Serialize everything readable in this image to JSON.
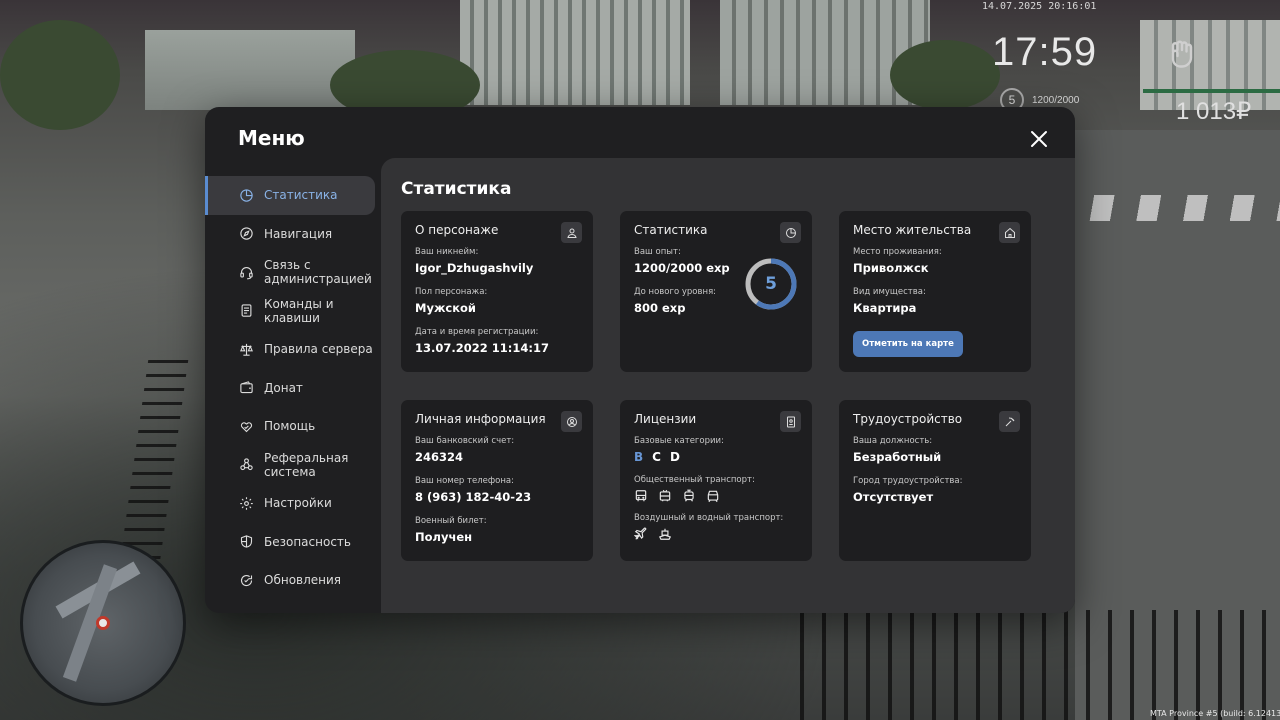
{
  "hud": {
    "datetime": "14.07.2025 20:16:01",
    "time": "17:59",
    "level": "5",
    "exp": "1200/2000",
    "money": "1 013₽",
    "build": "MTA Province #5 (build: 6.12413.9"
  },
  "menu": {
    "title": "Меню",
    "sidebar": [
      {
        "label": "Статистика",
        "icon": "pie-chart-icon",
        "active": true
      },
      {
        "label": "Навигация",
        "icon": "compass-icon"
      },
      {
        "label": "Связь с администрацией",
        "icon": "headset-icon"
      },
      {
        "label": "Команды и клавиши",
        "icon": "document-icon"
      },
      {
        "label": "Правила сервера",
        "icon": "scales-icon"
      },
      {
        "label": "Донат",
        "icon": "wallet-icon"
      },
      {
        "label": "Помощь",
        "icon": "heart-hand-icon"
      },
      {
        "label": "Реферальная система",
        "icon": "network-icon"
      },
      {
        "label": "Настройки",
        "icon": "gear-icon"
      },
      {
        "label": "Безопасность",
        "icon": "shield-icon"
      },
      {
        "label": "Обновления",
        "icon": "refresh-icon"
      }
    ]
  },
  "content": {
    "title": "Статистика",
    "character": {
      "title": "О персонаже",
      "nickname_label": "Ваш никнейм:",
      "nickname": "Igor_Dzhugashvily",
      "gender_label": "Пол персонажа:",
      "gender": "Мужской",
      "reg_label": "Дата и время регистрации:",
      "reg": "13.07.2022 11:14:17"
    },
    "stats": {
      "title": "Статистика",
      "exp_label": "Ваш опыт:",
      "exp": "1200/2000 exp",
      "next_label": "До нового уровня:",
      "next": "800 exp",
      "level": "5",
      "progress": 0.6
    },
    "residence": {
      "title": "Место жительства",
      "place_label": "Место проживания:",
      "place": "Приволжск",
      "property_label": "Вид имущества:",
      "property": "Квартира",
      "map_button": "Отметить на карте"
    },
    "personal": {
      "title": "Личная информация",
      "bank_label": "Ваш банковский счет:",
      "bank": "246324",
      "phone_label": "Ваш номер телефона:",
      "phone": "8 (963) 182-40-23",
      "military_label": "Военный билет:",
      "military": "Получен"
    },
    "licenses": {
      "title": "Лицензии",
      "base_label": "Базовые категории:",
      "categories": [
        {
          "name": "B",
          "active": true
        },
        {
          "name": "C",
          "active": false
        },
        {
          "name": "D",
          "active": false
        }
      ],
      "public_label": "Общественный транспорт:",
      "public_icons": [
        "bus-icon",
        "trolleybus-icon",
        "tram-icon",
        "metro-icon"
      ],
      "air_label": "Воздушный и водный транспорт:",
      "air_icons": [
        "plane-icon",
        "boat-icon"
      ]
    },
    "employment": {
      "title": "Трудоустройство",
      "position_label": "Ваша должность:",
      "position": "Безработный",
      "city_label": "Город трудоустройства:",
      "city": "Отсутствует"
    }
  },
  "colors": {
    "accent": "#5a8cd0",
    "active_text": "#89b2e6",
    "button": "#4d78b6",
    "panel": "#1f1f21",
    "content_bg": "#333335",
    "card_bg": "#1e1e20"
  }
}
